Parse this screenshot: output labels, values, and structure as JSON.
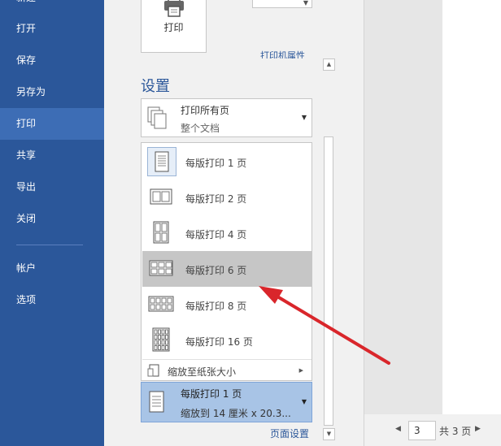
{
  "sidebar": {
    "items": [
      {
        "label": "新建"
      },
      {
        "label": "打开"
      },
      {
        "label": "保存"
      },
      {
        "label": "另存为"
      },
      {
        "label": "打印",
        "active": true
      },
      {
        "label": "共享"
      },
      {
        "label": "导出"
      },
      {
        "label": "关闭"
      },
      {
        "label": "帐户"
      },
      {
        "label": "选项"
      }
    ]
  },
  "print": {
    "button_label": "打印",
    "printer_properties_link": "打印机属性"
  },
  "settings": {
    "heading": "设置",
    "range_dropdown": {
      "title": "打印所有页",
      "subtitle": "整个文档"
    },
    "pages_per_sheet_menu": {
      "options": [
        {
          "label": "每版打印 1 页",
          "icon": "1-page-icon"
        },
        {
          "label": "每版打印 2 页",
          "icon": "2-pages-icon"
        },
        {
          "label": "每版打印 4 页",
          "icon": "4-pages-icon"
        },
        {
          "label": "每版打印 6 页",
          "icon": "6-pages-icon",
          "highlighted": true
        },
        {
          "label": "每版打印 8 页",
          "icon": "8-pages-icon"
        },
        {
          "label": "每版打印 16 页",
          "icon": "16-pages-icon"
        }
      ],
      "scale_option": "缩放至纸张大小"
    },
    "pages_per_sheet_dropdown": {
      "title": "每版打印 1 页",
      "subtitle": "缩放到 14 厘米 x 20.3..."
    },
    "page_setup_link": "页面设置"
  },
  "pager": {
    "current_page": "3",
    "total_label": "共 3 页"
  },
  "colors": {
    "accent": "#2b579a",
    "sidebar_active": "#3d6db5",
    "highlight": "#c6c6c6",
    "selected_dropdown": "#a8c4e6"
  }
}
